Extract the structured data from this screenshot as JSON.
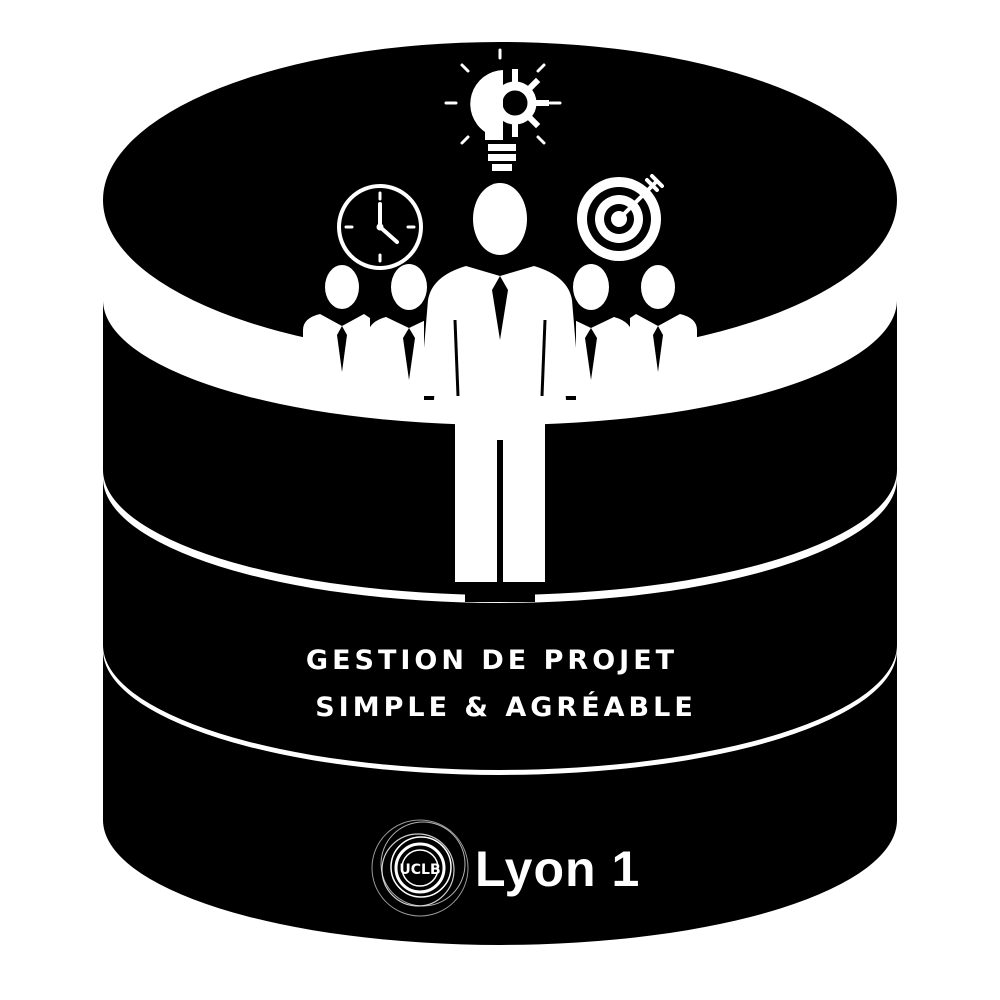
{
  "tagline": {
    "line1": "GESTION DE PROJET",
    "line2": "SIMPLE & AGRÉABLE"
  },
  "logo": {
    "seal_letters": "UCLB",
    "name": "Lyon 1"
  },
  "icons": [
    "lightbulb-gear-icon",
    "clock-icon",
    "target-icon",
    "team-icon"
  ],
  "colors": {
    "foreground": "#000000",
    "background": "#ffffff"
  }
}
